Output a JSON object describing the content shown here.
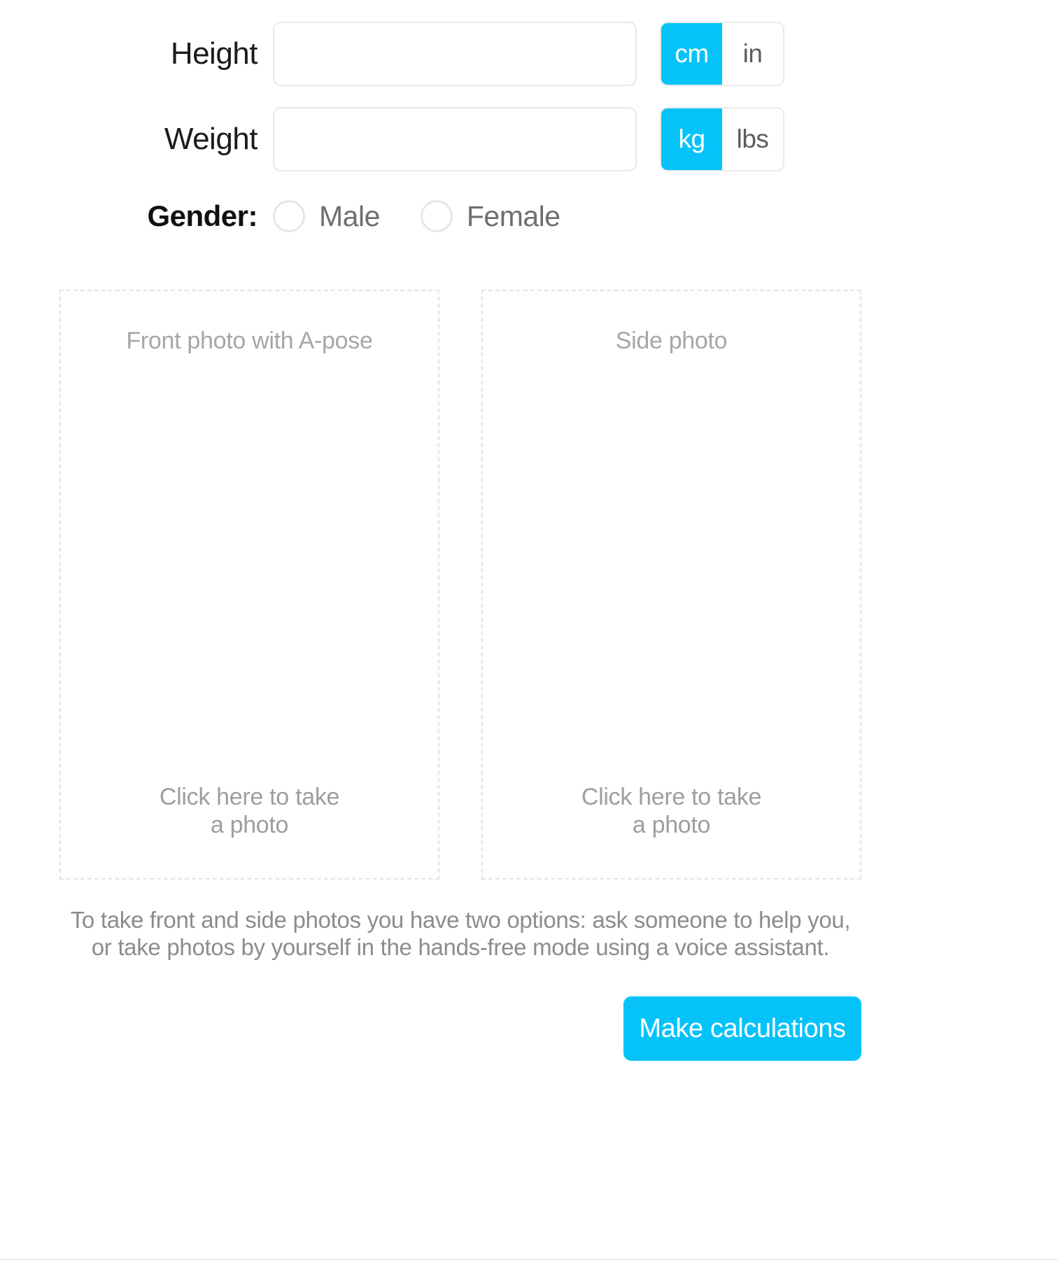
{
  "form": {
    "height": {
      "label": "Height",
      "value": "",
      "placeholder": "",
      "units": [
        {
          "label": "cm",
          "active": true
        },
        {
          "label": "in",
          "active": false
        }
      ]
    },
    "weight": {
      "label": "Weight",
      "value": "",
      "placeholder": "",
      "units": [
        {
          "label": "kg",
          "active": true
        },
        {
          "label": "lbs",
          "active": false
        }
      ]
    },
    "gender": {
      "label": "Gender:",
      "options": [
        {
          "label": "Male",
          "selected": false
        },
        {
          "label": "Female",
          "selected": false
        }
      ]
    }
  },
  "photos": {
    "front": {
      "title": "Front photo with A-pose",
      "cta_line1": "Click here to take",
      "cta_line2": "a photo"
    },
    "side": {
      "title": "Side photo",
      "cta_line1": "Click here to take",
      "cta_line2": "a photo"
    }
  },
  "hint": {
    "line1": "To take front and side photos you have two options: ask someone to help you,",
    "line2": "or take photos by yourself in the hands-free mode using a voice assistant."
  },
  "actions": {
    "submit_label": "Make calculations"
  },
  "colors": {
    "accent": "#05c3f9",
    "border": "#e8e8e8",
    "dashed_border": "#e3e3e3",
    "muted_text": "#9e9e9e",
    "label_text": "#1c1c1c"
  }
}
